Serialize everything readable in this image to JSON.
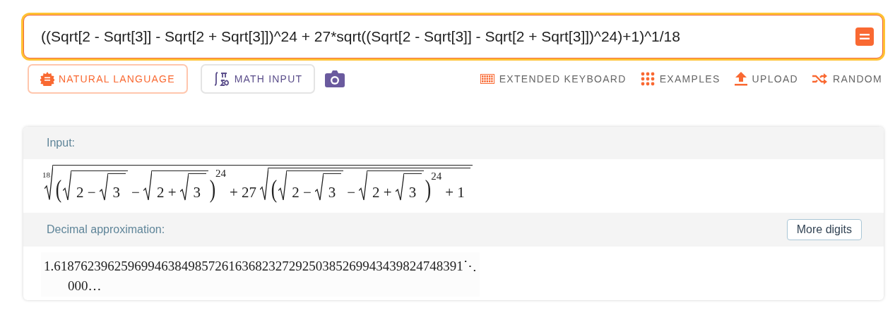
{
  "query": {
    "value": "((Sqrt[2 - Sqrt[3]] - Sqrt[2 + Sqrt[3]])^24 + 27*sqrt((Sqrt[2 - Sqrt[3]] - Sqrt[2 + Sqrt[3]])^24)+1)^1/18"
  },
  "modes": [
    {
      "label": "NATURAL LANGUAGE",
      "kind": "natural",
      "selected": true
    },
    {
      "label": "MATH INPUT",
      "kind": "math",
      "selected": false
    }
  ],
  "tools": [
    {
      "label": "EXTENDED KEYBOARD",
      "kind": "keyboard"
    },
    {
      "label": "EXAMPLES",
      "kind": "examples"
    },
    {
      "label": "UPLOAD",
      "kind": "upload"
    },
    {
      "label": "RANDOM",
      "kind": "random"
    }
  ],
  "pods": [
    {
      "title": "Input:",
      "kind": "formula",
      "formula": {
        "kind": "root",
        "index": "18",
        "body": [
          {
            "kind": "group",
            "open": "(",
            "close": ")",
            "sup": "24",
            "body": [
              {
                "kind": "sqrt",
                "body": [
                  {
                    "kind": "text",
                    "text": "2 −"
                  },
                  {
                    "kind": "sqrt",
                    "body": [
                      {
                        "kind": "text",
                        "text": "3"
                      }
                    ]
                  }
                ]
              },
              {
                "kind": "text",
                "text": "−"
              },
              {
                "kind": "sqrt",
                "body": [
                  {
                    "kind": "text",
                    "text": "2 +"
                  },
                  {
                    "kind": "sqrt",
                    "body": [
                      {
                        "kind": "text",
                        "text": "3"
                      }
                    ]
                  }
                ]
              }
            ]
          },
          {
            "kind": "text",
            "text": "+ 27"
          },
          {
            "kind": "sqrt",
            "body": [
              {
                "kind": "group",
                "open": "(",
                "close": ")",
                "sup": "24",
                "body": [
                  {
                    "kind": "sqrt",
                    "body": [
                      {
                        "kind": "text",
                        "text": "2 −"
                      },
                      {
                        "kind": "sqrt",
                        "body": [
                          {
                            "kind": "text",
                            "text": "3"
                          }
                        ]
                      }
                    ]
                  },
                  {
                    "kind": "text",
                    "text": "−"
                  },
                  {
                    "kind": "sqrt",
                    "body": [
                      {
                        "kind": "text",
                        "text": "2 +"
                      },
                      {
                        "kind": "sqrt",
                        "body": [
                          {
                            "kind": "text",
                            "text": "3"
                          }
                        ]
                      }
                    ]
                  }
                ]
              },
              {
                "kind": "text",
                "text": "+ 1"
              }
            ]
          }
        ]
      }
    },
    {
      "title": "Decimal approximation:",
      "kind": "decimal",
      "button": "More digits",
      "lines": [
        "1.6187623962596994638498572616368232729250385269943439824748391",
        "000…"
      ],
      "continuation": "⋱"
    }
  ]
}
